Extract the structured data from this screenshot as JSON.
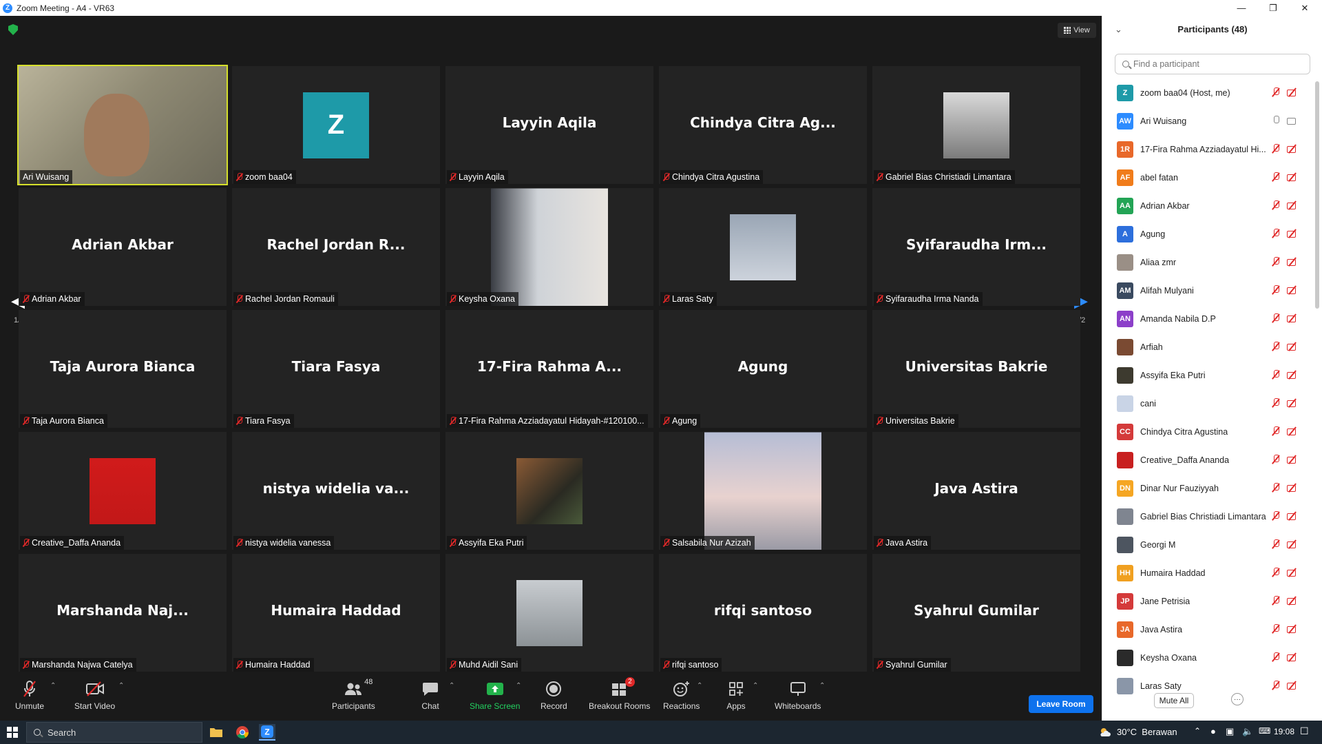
{
  "window": {
    "title": "Zoom Meeting - A4 - VR63"
  },
  "view_button": {
    "label": "View"
  },
  "grid": {
    "page_left": "1/2",
    "page_right": "1/2",
    "tiles": [
      {
        "big": "",
        "label": "Ari Wuisang",
        "kind": "video",
        "icon": "video-feed"
      },
      {
        "big": "",
        "label": "zoom baa04",
        "kind": "avatar",
        "avatar_letter": "Z"
      },
      {
        "big": "Layyin Aqila",
        "label": "Layyin Aqila",
        "kind": "name"
      },
      {
        "big": "Chindya  Citra  Ag...",
        "label": "Chindya Citra Agustina",
        "kind": "name"
      },
      {
        "big": "",
        "label": "Gabriel Bias Christiadi Limantara",
        "kind": "photo",
        "icon": "profile-photo"
      },
      {
        "big": "Adrian Akbar",
        "label": "Adrian Akbar",
        "kind": "name"
      },
      {
        "big": "Rachel Jordan  R...",
        "label": "Rachel Jordan Romauli",
        "kind": "name"
      },
      {
        "big": "",
        "label": "Keysha Oxana",
        "kind": "photo",
        "icon": "profile-photo"
      },
      {
        "big": "",
        "label": "Laras Saty",
        "kind": "photo",
        "icon": "profile-photo"
      },
      {
        "big": "Syifaraudha  Irm...",
        "label": "Syifaraudha Irma Nanda",
        "kind": "name"
      },
      {
        "big": "Taja Aurora Bianca",
        "label": "Taja Aurora Bianca",
        "kind": "name"
      },
      {
        "big": "Tiara Fasya",
        "label": "Tiara Fasya",
        "kind": "name"
      },
      {
        "big": "17-Fira  Rahma  A...",
        "label": "17-Fira Rahma Azziadayatul Hidayah-#120100...",
        "kind": "name"
      },
      {
        "big": "Agung",
        "label": "Agung",
        "kind": "name"
      },
      {
        "big": "Universitas Bakrie",
        "label": "Universitas Bakrie",
        "kind": "name"
      },
      {
        "big": "",
        "label": "Creative_Daffa Ananda",
        "kind": "photo",
        "icon": "profile-photo"
      },
      {
        "big": "nistya  widelia  va...",
        "label": "nistya widelia vanessa",
        "kind": "name"
      },
      {
        "big": "",
        "label": "Assyifa Eka Putri",
        "kind": "photo",
        "icon": "profile-photo"
      },
      {
        "big": "",
        "label": "Salsabila Nur Azizah",
        "kind": "photo",
        "icon": "profile-photo"
      },
      {
        "big": "Java Astira",
        "label": "Java Astira",
        "kind": "name"
      },
      {
        "big": "Marshanda  Naj...",
        "label": "Marshanda Najwa Catelya",
        "kind": "name"
      },
      {
        "big": "Humaira Haddad",
        "label": "Humaira Haddad",
        "kind": "name"
      },
      {
        "big": "",
        "label": "Muhd Aidil Sani",
        "kind": "photo",
        "icon": "profile-photo"
      },
      {
        "big": "rifqi santoso",
        "label": "rifqi santoso",
        "kind": "name"
      },
      {
        "big": "Syahrul Gumilar",
        "label": "Syahrul Gumilar",
        "kind": "name"
      }
    ]
  },
  "toolbar": {
    "unmute": "Unmute",
    "start_video": "Start Video",
    "participants": "Participants",
    "participants_count": "48",
    "chat": "Chat",
    "share_screen": "Share Screen",
    "record": "Record",
    "breakout_rooms": "Breakout Rooms",
    "breakout_badge": "2",
    "reactions": "Reactions",
    "apps": "Apps",
    "whiteboards": "Whiteboards",
    "leave": "Leave Room"
  },
  "panel": {
    "title": "Participants (48)",
    "search_placeholder": "Find a participant",
    "mute_all": "Mute All",
    "more": "···",
    "participants": [
      {
        "initials": "Z",
        "name": "zoom baa04 (Host, me)",
        "color": "#1e9aa8",
        "mic": "off",
        "cam": "off"
      },
      {
        "initials": "AW",
        "name": "Ari Wuisang",
        "color": "#2d8cff",
        "mic": "on",
        "cam": "on"
      },
      {
        "initials": "1R",
        "name": "17-Fira Rahma Azziadayatul Hi...",
        "color": "#e8682a",
        "mic": "off",
        "cam": "off"
      },
      {
        "initials": "AF",
        "name": "abel fatan",
        "color": "#f07c1b",
        "mic": "off",
        "cam": "off"
      },
      {
        "initials": "AA",
        "name": "Adrian Akbar",
        "color": "#23a455",
        "mic": "off",
        "cam": "off"
      },
      {
        "initials": "A",
        "name": "Agung",
        "color": "#2d6fdc",
        "mic": "off",
        "cam": "off"
      },
      {
        "initials": "",
        "name": "Aliaa zmr",
        "color": "#9a8f86",
        "mic": "off",
        "cam": "off"
      },
      {
        "initials": "AM",
        "name": "Alifah Mulyani",
        "color": "#3a4a60",
        "mic": "off",
        "cam": "off"
      },
      {
        "initials": "AN",
        "name": "Amanda Nabila D.P",
        "color": "#8c3fc9",
        "mic": "off",
        "cam": "off"
      },
      {
        "initials": "",
        "name": "Arfiah",
        "color": "#7a4a32",
        "mic": "off",
        "cam": "off"
      },
      {
        "initials": "",
        "name": "Assyifa Eka Putri",
        "color": "#3d3a2f",
        "mic": "off",
        "cam": "off"
      },
      {
        "initials": "",
        "name": "cani",
        "color": "#c9d4e6",
        "mic": "off",
        "cam": "off"
      },
      {
        "initials": "CC",
        "name": "Chindya Citra Agustina",
        "color": "#d43a3a",
        "mic": "off",
        "cam": "off"
      },
      {
        "initials": "",
        "name": "Creative_Daffa Ananda",
        "color": "#c82020",
        "mic": "off",
        "cam": "off"
      },
      {
        "initials": "DN",
        "name": "Dinar Nur Fauziyyah",
        "color": "#f5a623",
        "mic": "off",
        "cam": "off"
      },
      {
        "initials": "",
        "name": "Gabriel Bias Christiadi Limantara",
        "color": "#7f8590",
        "mic": "off",
        "cam": "off"
      },
      {
        "initials": "",
        "name": "Georgi M",
        "color": "#4d5560",
        "mic": "off",
        "cam": "off"
      },
      {
        "initials": "HH",
        "name": "Humaira Haddad",
        "color": "#f0a020",
        "mic": "off",
        "cam": "off"
      },
      {
        "initials": "JP",
        "name": "Jane Petrisia",
        "color": "#d43a3a",
        "mic": "off",
        "cam": "off"
      },
      {
        "initials": "JA",
        "name": "Java Astira",
        "color": "#e8682a",
        "mic": "off",
        "cam": "off"
      },
      {
        "initials": "",
        "name": "Keysha Oxana",
        "color": "#2a2a2a",
        "mic": "off",
        "cam": "off"
      },
      {
        "initials": "",
        "name": "Laras Saty",
        "color": "#8a96a8",
        "mic": "off",
        "cam": "off"
      }
    ]
  },
  "taskbar": {
    "search": "Search",
    "weather": "30°C  Berawan",
    "time": "19:08"
  }
}
